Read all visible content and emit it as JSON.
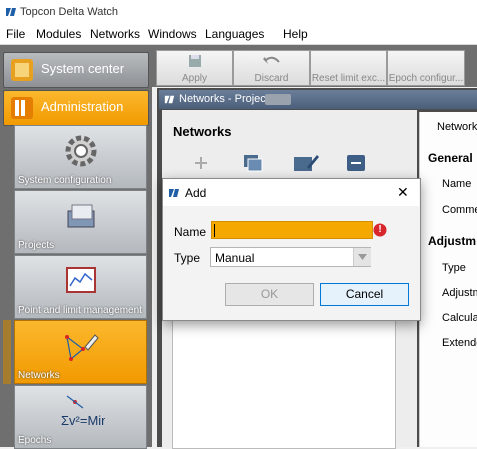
{
  "app": {
    "title": "Topcon Delta Watch"
  },
  "menu": [
    "File",
    "Modules",
    "Networks",
    "Windows",
    "Languages",
    "Help"
  ],
  "nav": {
    "system_center": "System center",
    "administration": "Administration",
    "tiles": [
      "System configuration",
      "Projects",
      "Point and limit management",
      "Networks",
      "Epochs"
    ]
  },
  "toolbar": [
    "Apply",
    "Discard",
    "Reset limit exc...",
    "Epoch configur..."
  ],
  "document": {
    "window_title": "Networks - Project:",
    "heading": "Networks"
  },
  "right_pane": {
    "tab": "Network",
    "general": "General",
    "name": "Name",
    "comment": "Comme",
    "adjust": "Adjustm",
    "type": "Type",
    "adjustment": "Adjustm",
    "calculation": "Calcula",
    "extended": "Extende"
  },
  "dialog": {
    "title": "Add",
    "name_label": "Name",
    "name_value": "",
    "type_label": "Type",
    "type_value": "Manual",
    "ok": "OK",
    "cancel": "Cancel",
    "close": "✕",
    "error_badge": "!"
  },
  "colors": {
    "accent": "#f5a800",
    "title_blue": "#4b5e7a",
    "error": "#d9262c"
  }
}
